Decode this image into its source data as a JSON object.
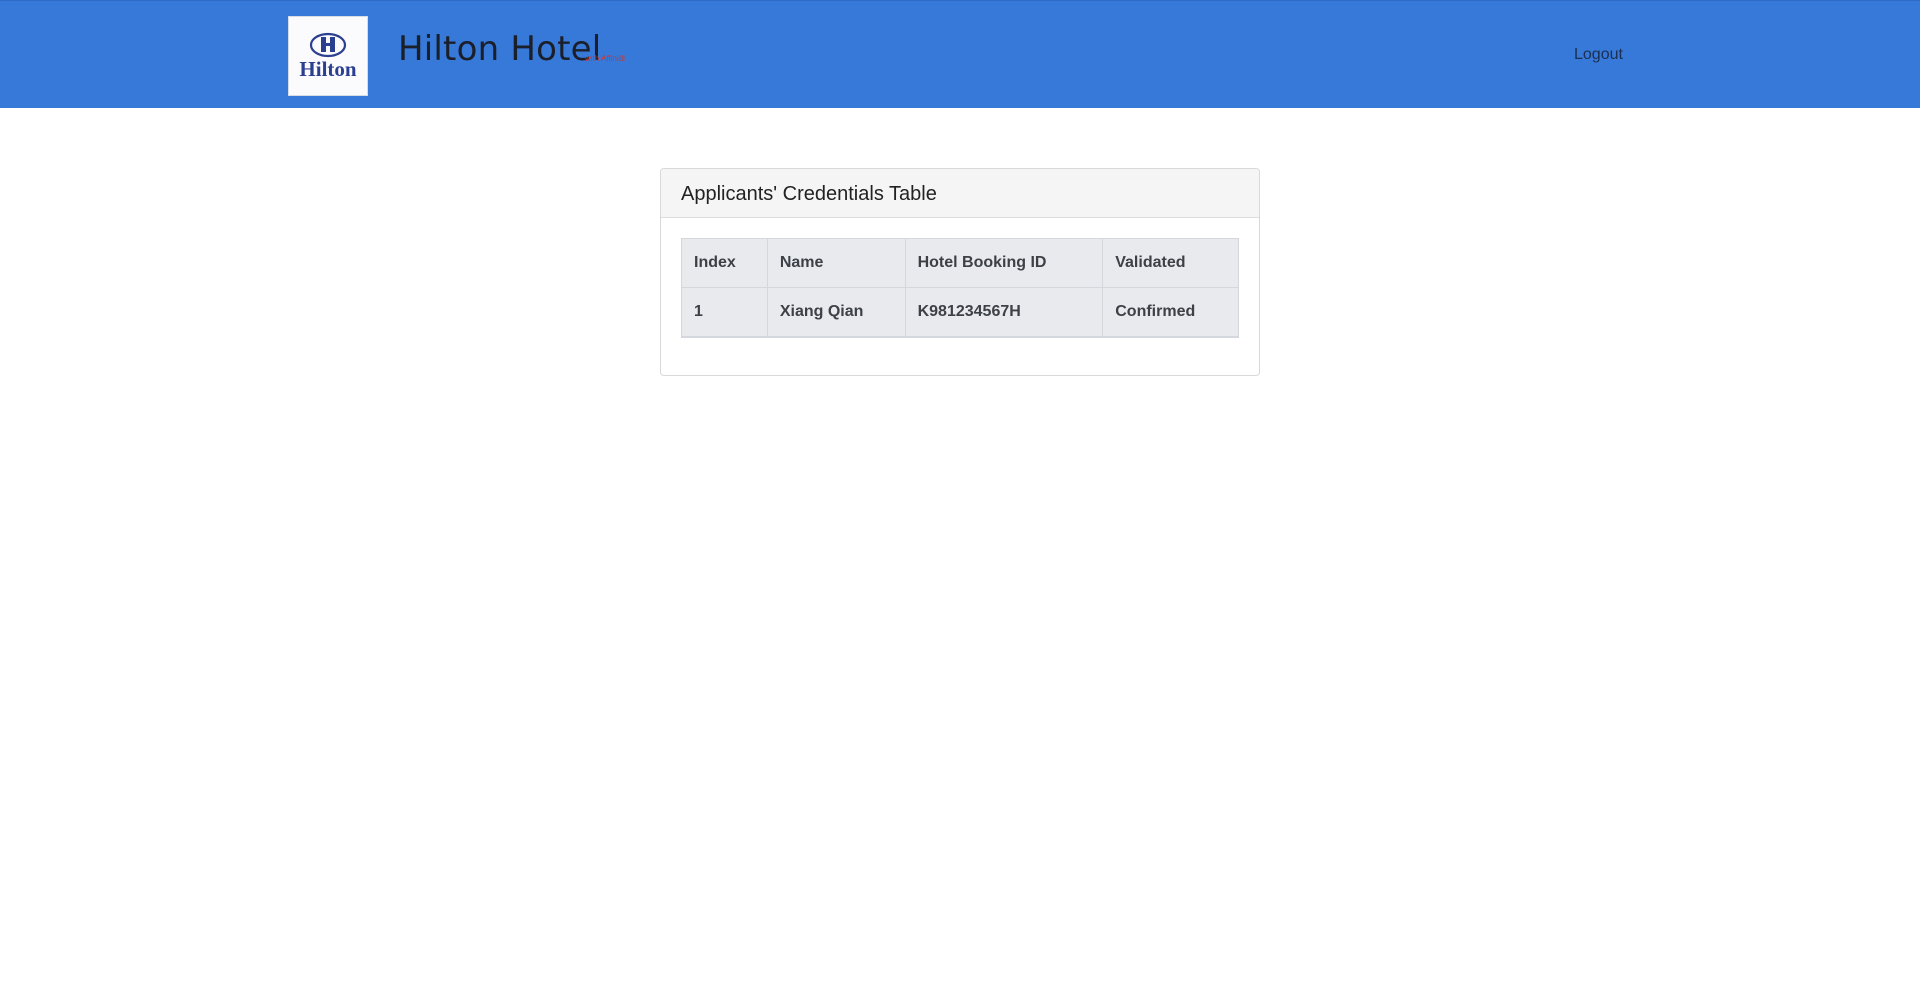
{
  "header": {
    "brand_title": "Hilton Hotel",
    "brand_subtitle": "with Affinidi",
    "logo_text": "Hilton",
    "logout_label": "Logout",
    "bg_color": "#3779d8"
  },
  "card": {
    "title": "Applicants' Credentials Table"
  },
  "table": {
    "columns": [
      "Index",
      "Name",
      "Hotel Booking ID",
      "Validated"
    ],
    "rows": [
      [
        "1",
        "Xiang Qian",
        "K981234567H",
        "Confirmed"
      ]
    ]
  }
}
